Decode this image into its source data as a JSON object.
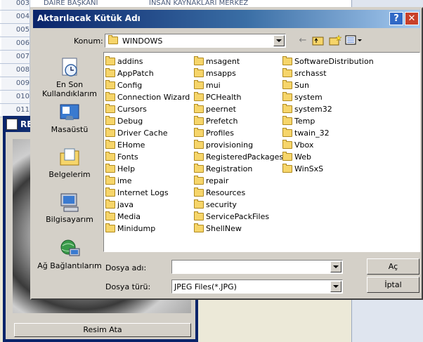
{
  "background": {
    "rows": [
      {
        "num": "003",
        "col1": "DAIRE BAŞKANI",
        "col2": "İNSAN KAYNAKLARI MERKEZ"
      },
      {
        "num": "004",
        "col1": "",
        "col2": ""
      },
      {
        "num": "005",
        "col1": "",
        "col2": ""
      },
      {
        "num": "006",
        "col1": "",
        "col2": ""
      },
      {
        "num": "007",
        "col1": "",
        "col2": ""
      },
      {
        "num": "008",
        "col1": "",
        "col2": ""
      },
      {
        "num": "009",
        "col1": "",
        "col2": ""
      },
      {
        "num": "010",
        "col1": "",
        "col2": ""
      },
      {
        "num": "011",
        "col1": "",
        "col2": ""
      }
    ],
    "picture_window": {
      "title": "RE",
      "button_label": "Resim Ata"
    }
  },
  "dialog": {
    "title": "Aktarılacak Kütük Adı",
    "help_glyph": "?",
    "close_glyph": "✕",
    "location_label": "Konum:",
    "location_value": "WINDOWS",
    "places": [
      {
        "label": "En Son Kullandıklarım",
        "icon": "recent-documents-icon"
      },
      {
        "label": "Masaüstü",
        "icon": "desktop-icon"
      },
      {
        "label": "Belgelerim",
        "icon": "my-documents-icon"
      },
      {
        "label": "Bilgisayarım",
        "icon": "my-computer-icon"
      },
      {
        "label": "Ağ Bağlantılarım",
        "icon": "network-places-icon"
      }
    ],
    "folders_col1": [
      "addins",
      "AppPatch",
      "Config",
      "Connection Wizard",
      "Cursors",
      "Debug",
      "Driver Cache",
      "EHome",
      "Fonts",
      "Help",
      "ime",
      "Internet Logs",
      "java",
      "Media",
      "Minidump"
    ],
    "folders_col2": [
      "msagent",
      "msapps",
      "mui",
      "PCHealth",
      "peernet",
      "Prefetch",
      "Profiles",
      "provisioning",
      "RegisteredPackages",
      "Registration",
      "repair",
      "Resources",
      "security",
      "ServicePackFiles",
      "ShellNew"
    ],
    "folders_col3": [
      "SoftwareDistribution",
      "srchasst",
      "Sun",
      "system",
      "system32",
      "Temp",
      "twain_32",
      "Vbox",
      "Web",
      "WinSxS"
    ],
    "filename_label": "Dosya adı:",
    "filename_value": "",
    "filetype_label": "Dosya türü:",
    "filetype_value": "JPEG Files(*.JPG)",
    "open_button": "Aç",
    "cancel_button": "İptal"
  }
}
